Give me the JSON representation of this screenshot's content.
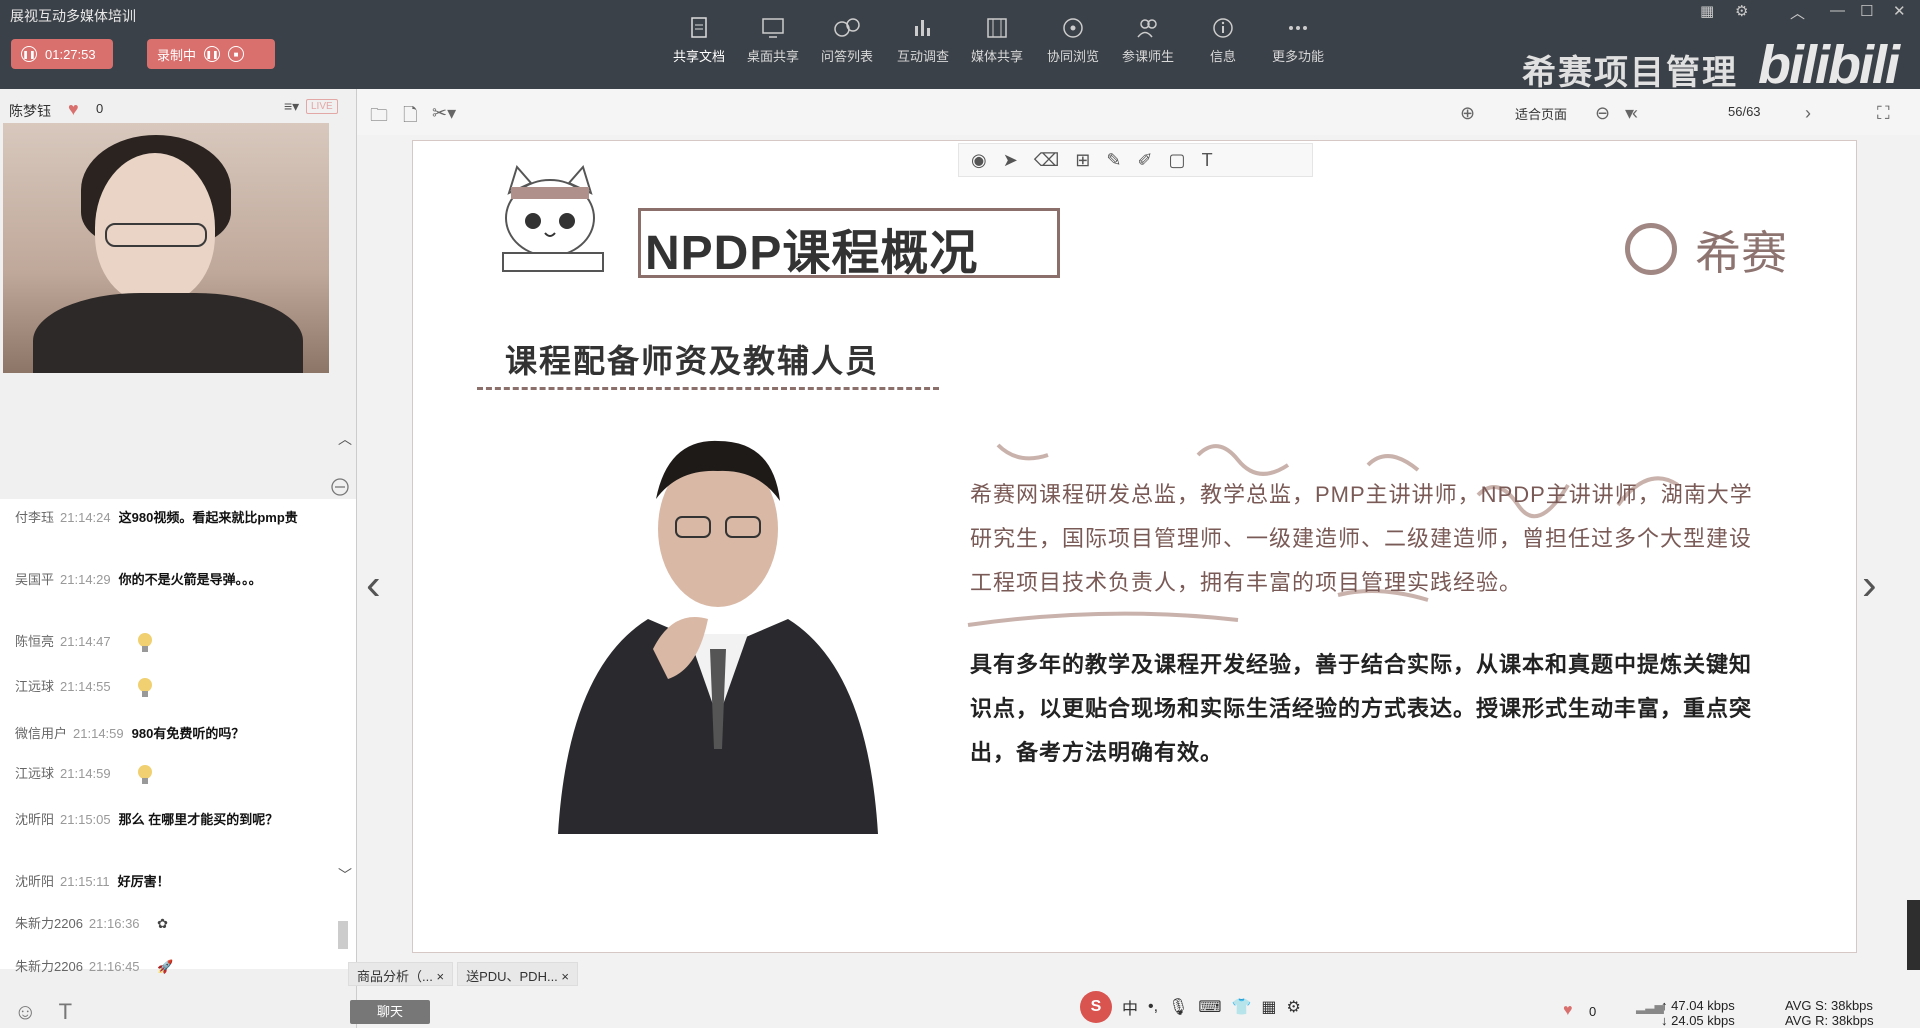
{
  "app_title": "展视互动多媒体培训",
  "timer": "01:27:53",
  "recording_label": "录制中",
  "toolbar_items": [
    {
      "label": "共享文档",
      "icon": "document-icon"
    },
    {
      "label": "桌面共享",
      "icon": "desktop-icon"
    },
    {
      "label": "问答列表",
      "icon": "qa-icon"
    },
    {
      "label": "互动调查",
      "icon": "survey-icon"
    },
    {
      "label": "媒体共享",
      "icon": "media-icon"
    },
    {
      "label": "协同浏览",
      "icon": "compass-icon"
    },
    {
      "label": "参课师生",
      "icon": "users-icon"
    },
    {
      "label": "信息",
      "icon": "info-icon"
    },
    {
      "label": "更多功能",
      "icon": "more-icon"
    }
  ],
  "brand_text": "希赛项目管理",
  "bilibili": "bilibili",
  "presenter": {
    "name": "陈梦钰",
    "likes": "0",
    "live": "LIVE"
  },
  "chat": [
    {
      "user": "付李珏",
      "time": "21:14:24",
      "text": "这980视频。看起来就比pmp贵"
    },
    {
      "user": "吴国平",
      "time": "21:14:29",
      "text": "你的不是火箭是导弹。。。"
    },
    {
      "user": "陈恒亮",
      "time": "21:14:47",
      "text": ""
    },
    {
      "user": "江远球",
      "time": "21:14:55",
      "text": ""
    },
    {
      "user": "微信用户",
      "time": "21:14:59",
      "text": "980有免费听的吗？"
    },
    {
      "user": "江远球",
      "time": "21:14:59",
      "text": ""
    },
    {
      "user": "沈昕阳",
      "time": "21:15:05",
      "text": "那么 在哪里才能买的到呢？"
    },
    {
      "user": "沈昕阳",
      "time": "21:15:11",
      "text": "好厉害！"
    },
    {
      "user": "朱新力2206",
      "time": "21:16:36",
      "text": ""
    },
    {
      "user": "朱新力2206",
      "time": "21:16:45",
      "text": ""
    }
  ],
  "doc": {
    "fit": "适合页面",
    "page": "56/63"
  },
  "slide": {
    "title": "NPDP课程概况",
    "logo": "希赛",
    "section": "课程配备师资及教辅人员",
    "bio1": "希赛网课程研发总监，教学总监，PMP主讲讲师，NPDP主讲讲师，湖南大学研究生，国际项目管理师、一级建造师、二级建造师，曾担任过多个大型建设工程项目技术负责人，拥有丰富的项目管理实践经验。",
    "bio2": "具有多年的教学及课程开发经验，善于结合实际，从课本和真题中提炼关键知识点，以更贴合现场和实际生活经验的方式表达。授课形式生动丰富，重点突出，备考方法明确有效。"
  },
  "tabs": [
    "商品分析（...",
    "送PDU、PDH..."
  ],
  "chat_button": "聊天",
  "ime": {
    "lang": "中"
  },
  "status": {
    "likes": "0",
    "up": "47.04 kbps",
    "down": "24.05 kbps",
    "avg_s": "AVG S: 38kbps",
    "avg_r": "AVG R: 38kbps"
  }
}
